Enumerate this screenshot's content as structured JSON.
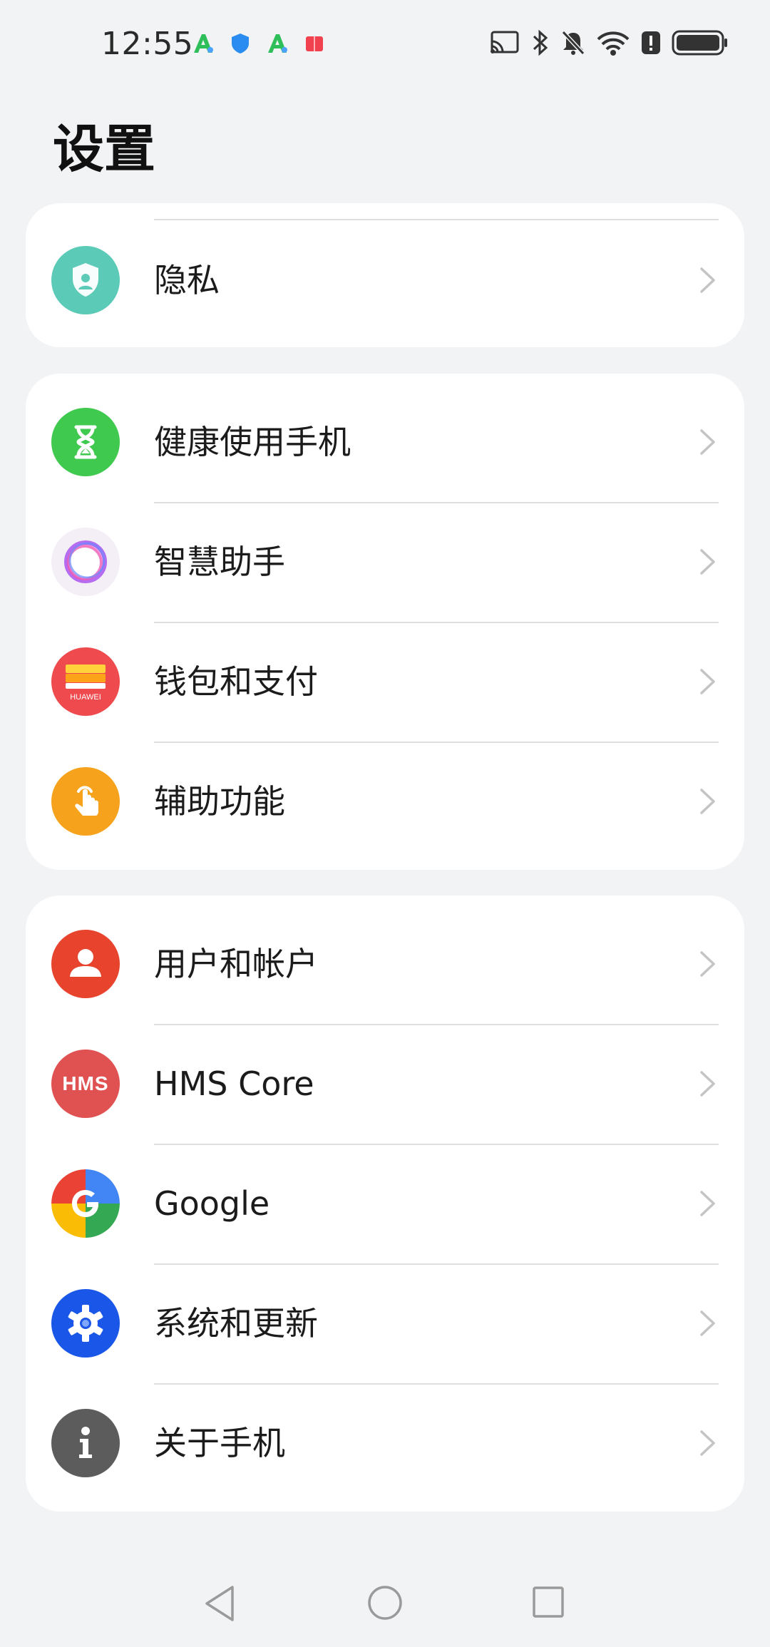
{
  "status_bar": {
    "time": "12:55",
    "notification_icons": [
      "app-a-icon",
      "shield-icon",
      "app-a-icon",
      "book-icon"
    ],
    "system_icons": [
      "cast-icon",
      "bluetooth-icon",
      "mute-icon",
      "wifi-icon",
      "alert-icon",
      "battery-icon"
    ]
  },
  "page": {
    "title": "设置"
  },
  "groups": [
    {
      "items": [
        {
          "id": "privacy",
          "label": "隐私",
          "icon": "privacy-shield-icon",
          "color": "#5bcbb8"
        }
      ]
    },
    {
      "items": [
        {
          "id": "digital-balance",
          "label": "健康使用手机",
          "icon": "hourglass-icon",
          "color": "#3fc94e"
        },
        {
          "id": "assistant",
          "label": "智慧助手",
          "icon": "assistant-orb-icon",
          "color": "#f4eef6"
        },
        {
          "id": "wallet",
          "label": "钱包和支付",
          "icon": "wallet-icon",
          "color": "#ef4a4e"
        },
        {
          "id": "accessibility",
          "label": "辅助功能",
          "icon": "hand-tap-icon",
          "color": "#f7a21c"
        }
      ]
    },
    {
      "items": [
        {
          "id": "users-accounts",
          "label": "用户和帐户",
          "icon": "user-icon",
          "color": "#e8432d"
        },
        {
          "id": "hms-core",
          "label": "HMS Core",
          "icon": "hms-icon",
          "color": "#e05252"
        },
        {
          "id": "google",
          "label": "Google",
          "icon": "google-icon",
          "color": "#4285f4"
        },
        {
          "id": "system-update",
          "label": "系统和更新",
          "icon": "gear-icon",
          "color": "#1a56e8"
        },
        {
          "id": "about-phone",
          "label": "关于手机",
          "icon": "info-icon",
          "color": "#5c5c5c"
        }
      ]
    }
  ],
  "wallet_icon_text": "HUAWEI",
  "hms_icon_text": "HMS",
  "nav_bar": {
    "buttons": [
      "back-icon",
      "home-icon",
      "recents-icon"
    ]
  }
}
